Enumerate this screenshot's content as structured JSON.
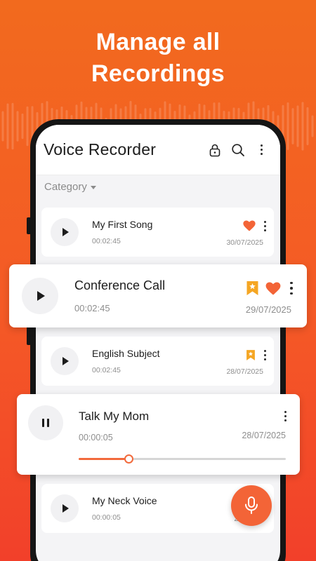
{
  "promo": {
    "headline_line1": "Manage all",
    "headline_line2": "Recordings"
  },
  "colors": {
    "accent": "#f36437",
    "background_top": "#f26a1e",
    "background_bottom": "#f2402a",
    "heart": "#f36437",
    "bookmark": "#f5a623"
  },
  "appbar": {
    "title": "Voice Recorder",
    "icons": [
      "lock-icon",
      "search-icon",
      "more-vertical-icon"
    ]
  },
  "filter": {
    "category_label": "Category"
  },
  "recordings": [
    {
      "name": "My First Song",
      "duration": "00:02:45",
      "date": "30/07/2025",
      "favorite": true,
      "bookmarked": false,
      "playing": false
    },
    {
      "name": "Conference Call",
      "duration": "00:02:45",
      "date": "29/07/2025",
      "favorite": true,
      "bookmarked": true,
      "playing": false
    },
    {
      "name": "English Subject",
      "duration": "00:02:45",
      "date": "28/07/2025",
      "favorite": false,
      "bookmarked": true,
      "playing": false
    },
    {
      "name": "Talk My Mom",
      "duration": "00:00:05",
      "date": "28/07/2025",
      "favorite": false,
      "bookmarked": false,
      "playing": true,
      "progress": 0.24
    },
    {
      "name": "My Neck Voice",
      "duration": "00:00:05",
      "date": "22/",
      "favorite": false,
      "bookmarked": false,
      "playing": false
    }
  ],
  "fab": {
    "icon": "microphone-icon"
  }
}
